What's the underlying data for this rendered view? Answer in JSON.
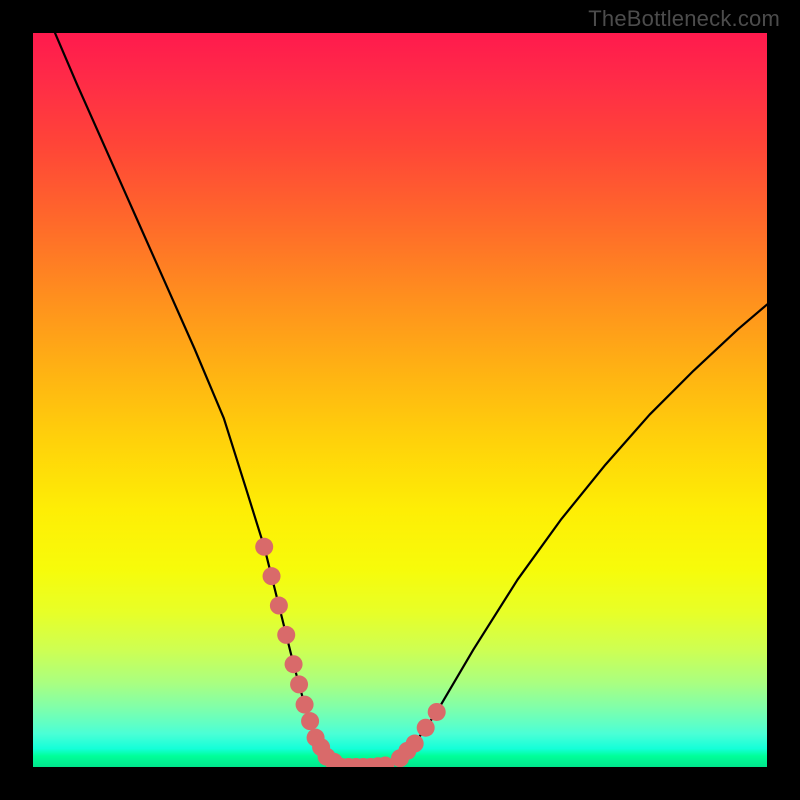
{
  "watermark": "TheBottleneck.com",
  "chart_data": {
    "type": "line",
    "title": "",
    "xlabel": "",
    "ylabel": "",
    "xlim": [
      0,
      100
    ],
    "ylim": [
      0,
      100
    ],
    "grid": false,
    "legend": false,
    "series": [
      {
        "name": "curve",
        "color": "#000000",
        "x": [
          3,
          6,
          10,
          14,
          18,
          22,
          26,
          29,
          31.5,
          33.5,
          35.5,
          37,
          38.5,
          40,
          42,
          44,
          46,
          48,
          50,
          52,
          55,
          60,
          66,
          72,
          78,
          84,
          90,
          96,
          100
        ],
        "y": [
          100,
          93,
          84,
          75,
          66,
          57,
          47.5,
          38,
          30,
          22,
          14,
          8.5,
          4,
          1.4,
          0,
          0,
          0,
          0.2,
          1.2,
          3.2,
          7.5,
          16,
          25.5,
          33.8,
          41.2,
          48,
          54,
          59.6,
          63
        ]
      },
      {
        "name": "highlight-left",
        "color": "#d96a6a",
        "style": "dotted-wide",
        "x": [
          31.5,
          33.5,
          35.5,
          37,
          38.5,
          40,
          42
        ],
        "y": [
          30,
          22,
          14,
          8.5,
          4,
          1.4,
          0
        ]
      },
      {
        "name": "highlight-floor",
        "color": "#d96a6a",
        "style": "dotted-wide",
        "x": [
          42,
          44,
          46,
          48
        ],
        "y": [
          0,
          0,
          0,
          0.2
        ]
      },
      {
        "name": "highlight-right",
        "color": "#d96a6a",
        "style": "dotted-wide",
        "x": [
          50,
          52,
          55
        ],
        "y": [
          1.2,
          3.2,
          7.5
        ]
      }
    ]
  }
}
